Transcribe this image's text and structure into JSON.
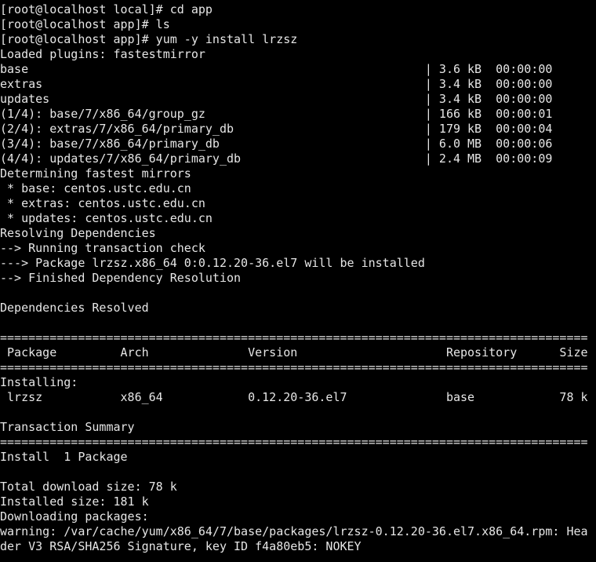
{
  "terminal": {
    "colors": {
      "background": "#000000",
      "foreground": "#e6e6e6"
    },
    "lines": [
      "[root@localhost local]# cd app",
      "[root@localhost app]# ls",
      "[root@localhost app]# yum -y install lrzsz",
      "Loaded plugins: fastestmirror",
      "base                                                        | 3.6 kB  00:00:00",
      "extras                                                      | 3.4 kB  00:00:00",
      "updates                                                     | 3.4 kB  00:00:00",
      "(1/4): base/7/x86_64/group_gz                               | 166 kB  00:00:01",
      "(2/4): extras/7/x86_64/primary_db                           | 179 kB  00:00:04",
      "(3/4): base/7/x86_64/primary_db                             | 6.0 MB  00:00:06",
      "(4/4): updates/7/x86_64/primary_db                          | 2.4 MB  00:00:09",
      "Determining fastest mirrors",
      " * base: centos.ustc.edu.cn",
      " * extras: centos.ustc.edu.cn",
      " * updates: centos.ustc.edu.cn",
      "Resolving Dependencies",
      "--> Running transaction check",
      "---> Package lrzsz.x86_64 0:0.12.20-36.el7 will be installed",
      "--> Finished Dependency Resolution",
      "",
      "Dependencies Resolved",
      "",
      "===================================================================================",
      " Package         Arch              Version                     Repository      Size",
      "===================================================================================",
      "Installing:",
      " lrzsz           x86_64            0.12.20-36.el7              base            78 k",
      "",
      "Transaction Summary",
      "===================================================================================",
      "Install  1 Package",
      "",
      "Total download size: 78 k",
      "Installed size: 181 k",
      "Downloading packages:",
      "warning: /var/cache/yum/x86_64/7/base/packages/lrzsz-0.12.20-36.el7.x86_64.rpm: Hea",
      "der V3 RSA/SHA256 Signature, key ID f4a80eb5: NOKEY"
    ]
  }
}
